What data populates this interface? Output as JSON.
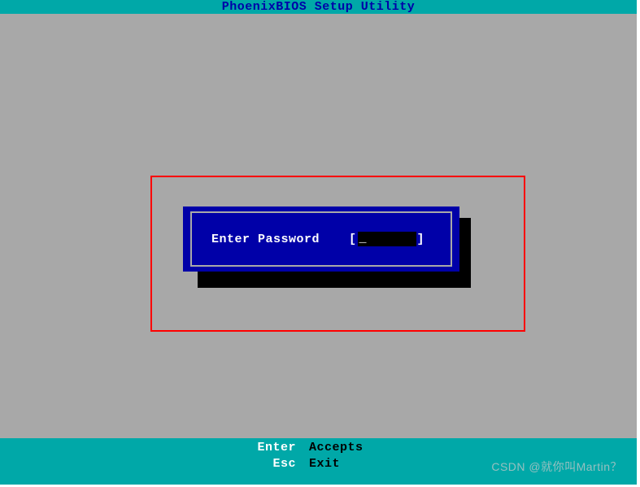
{
  "header": {
    "title": "PhoenixBIOS Setup Utility"
  },
  "dialog": {
    "label": "Enter Password",
    "bracket_open": "[",
    "bracket_close": "]",
    "value": "_"
  },
  "footer": {
    "rows": [
      {
        "key": "Enter",
        "action": "Accepts"
      },
      {
        "key": "Esc",
        "action": "Exit"
      }
    ]
  },
  "watermark": "CSDN @就你叫Martin？"
}
